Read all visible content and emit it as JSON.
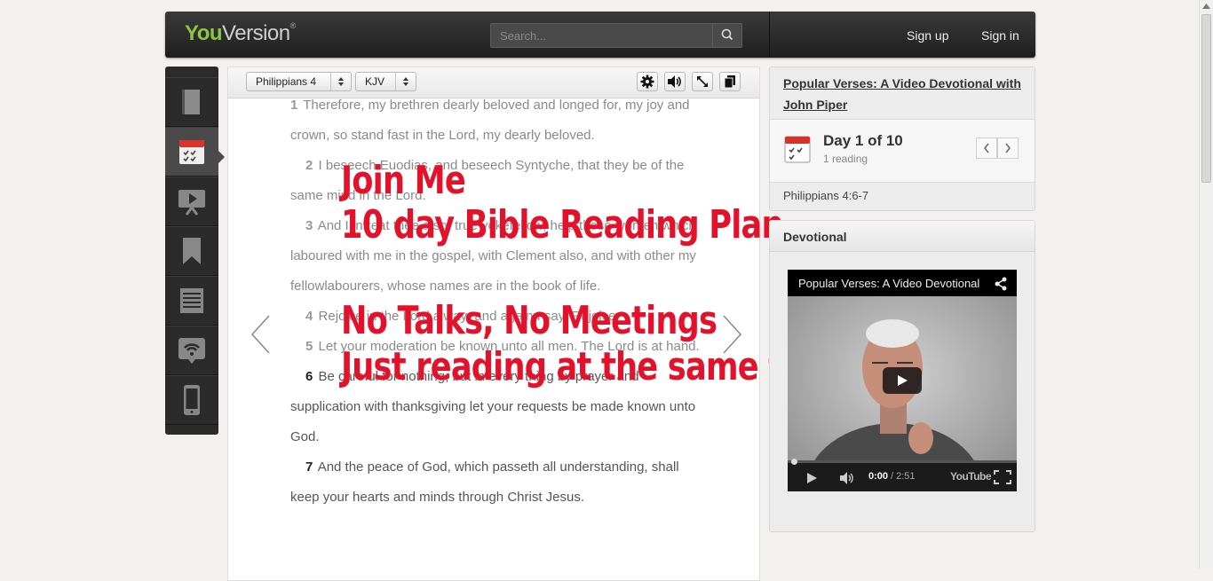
{
  "header": {
    "logo_you": "You",
    "logo_version": "Version",
    "search_placeholder": "Search...",
    "sign_up": "Sign up",
    "sign_in": "Sign in"
  },
  "dock": {
    "items": [
      "book-icon",
      "calendar-check-icon",
      "video-icon",
      "bookmark-icon",
      "list-icon",
      "wifi-icon",
      "phone-icon"
    ],
    "active_index": 1
  },
  "reader": {
    "book_chapter": "Philippians 4",
    "version": "KJV",
    "verses": [
      {
        "num": "1",
        "text": "Therefore, my brethren dearly beloved and longed for, my joy and crown, so stand fast in the Lord, my dearly beloved."
      },
      {
        "num": "2",
        "text": "I beseech Euodias, and beseech Syntyche, that they be of the same mind in the Lord."
      },
      {
        "num": "3",
        "text": "And I intreat thee also, true yokefellow, help those women which laboured with me in the gospel, with Clement also, and with other my fellowlabourers, whose names are in the book of life."
      },
      {
        "num": "4",
        "text": "Rejoice in the Lord alway: and again I say, Rejoice."
      },
      {
        "num": "5",
        "text": "Let your moderation be known unto all men. The Lord is at hand."
      },
      {
        "num": "6",
        "text": "Be careful for nothing; but in every thing by prayer and supplication with thanksgiving let your requests be made known unto God."
      },
      {
        "num": "7",
        "text": "And the peace of God, which passeth all understanding, shall keep your hearts and minds through Christ Jesus."
      }
    ]
  },
  "overlay": {
    "line1": "Join Me",
    "line2": "10 day Bible Reading Plan",
    "line3": "No Talks, No Meetings",
    "line4": "Just reading at the same time",
    "color": "#e3122b"
  },
  "plan": {
    "title": "Popular Verses: A Video Devotional with John Piper",
    "day": "Day 1 of 10",
    "readings": "1 reading",
    "reference": "Philippians 4:6-7"
  },
  "devotional": {
    "heading": "Devotional",
    "video_title": "Popular Verses: A Video Devotional",
    "time_current": "0:00",
    "time_total": "/ 2:51",
    "brand": "YouTube",
    "progress": 0
  }
}
